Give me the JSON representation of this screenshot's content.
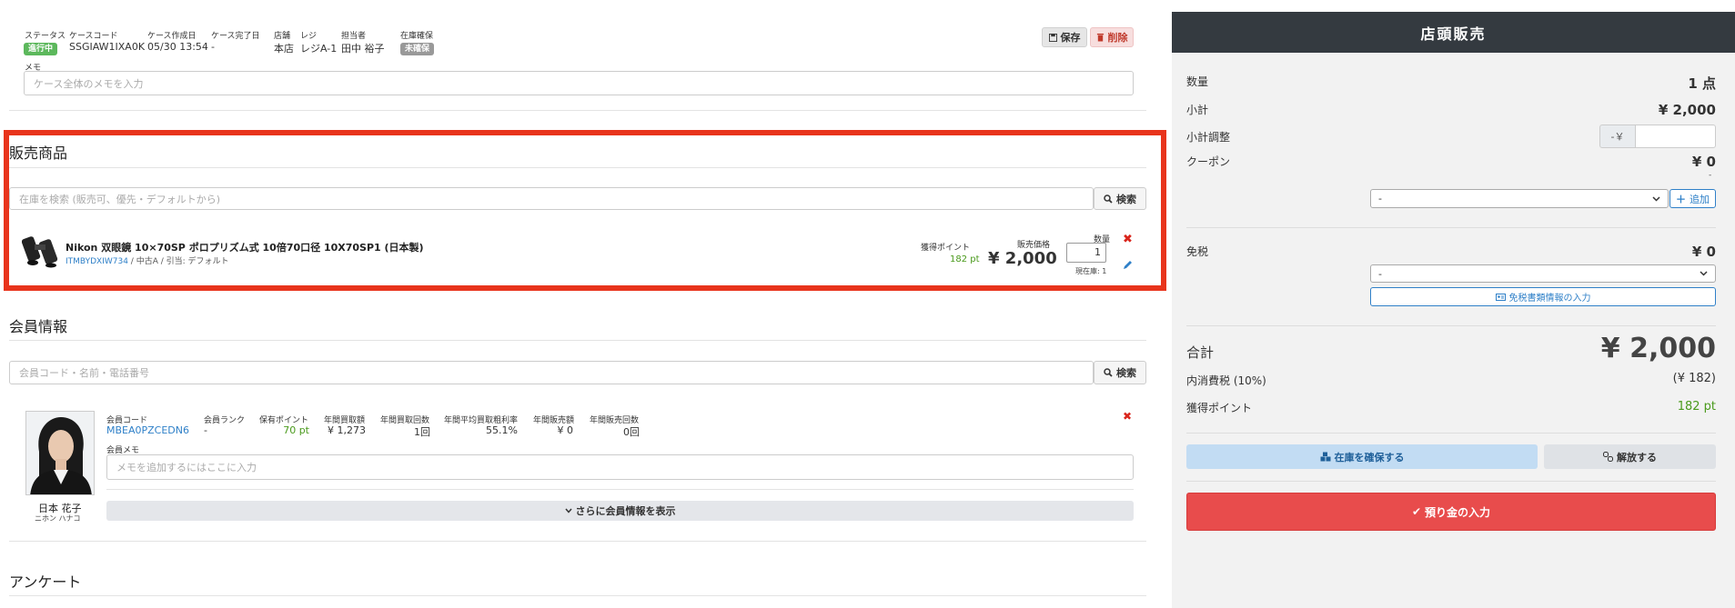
{
  "case": {
    "status_label": "ステータス",
    "status_value": "進行中",
    "status_color": "#5cb85c",
    "code_label": "ケースコード",
    "code_value": "SSGIAW1IXA0K",
    "created_label": "ケース作成日",
    "created_value": "05/30 13:54",
    "completed_label": "ケース完了日",
    "completed_value": "-",
    "store_label": "店舗",
    "store_value": "本店",
    "register_label": "レジ",
    "register_value": "レジA-1",
    "staff_label": "担当者",
    "staff_value": "田中 裕子",
    "stock_label": "在庫確保",
    "stock_value": "未確保",
    "save_label": "保存",
    "delete_label": "削除",
    "memo_label": "メモ",
    "memo_placeholder": "ケース全体のメモを入力"
  },
  "products": {
    "title": "販売商品",
    "search_placeholder": "在庫を検索 (販売可、優先・デフォルトから)",
    "search_button": "検索",
    "item": {
      "name": "Nikon 双眼鏡 10×70SP ポロプリズム式 10倍70口径 10X70SP1 (日本製)",
      "code": "ITMBYDXIW734",
      "meta": " / 中古A / 引当: デフォルト",
      "points_label": "獲得ポイント",
      "points_value": "182 pt",
      "price_label": "販売価格",
      "price_value": "¥ 2,000",
      "qty_label": "数量",
      "qty_value": "1",
      "stock_text": "現在庫: 1"
    }
  },
  "member": {
    "title": "会員情報",
    "search_placeholder": "会員コード・名前・電話番号",
    "search_button": "検索",
    "name": "日本 花子",
    "kana": "ニホン ハナコ",
    "code_label": "会員コード",
    "code_value": "MBEA0PZCEDN6",
    "rank_label": "会員ランク",
    "rank_value": "-",
    "points_label": "保有ポイント",
    "points_value": "70 pt",
    "buy_amount_label": "年間買取額",
    "buy_amount_value": "¥ 1,273",
    "buy_count_label": "年間買取回数",
    "buy_count_value": "1回",
    "margin_label": "年間平均買取粗利率",
    "margin_value": "55.1%",
    "sale_amount_label": "年間販売額",
    "sale_amount_value": "¥ 0",
    "sale_count_label": "年間販売回数",
    "sale_count_value": "0回",
    "memo_label": "会員メモ",
    "memo_placeholder": "メモを追加するにはここに入力",
    "more_button": "さらに会員情報を表示"
  },
  "survey": {
    "title": "アンケート"
  },
  "sidebar": {
    "title": "店頭販売",
    "qty_label": "数量",
    "qty_value": "1 点",
    "subtotal_label": "小計",
    "subtotal_value": "¥ 2,000",
    "adjust_label": "小計調整",
    "adjust_prefix": "-￥",
    "coupon_label": "クーポン",
    "coupon_value": "¥ 0",
    "coupon_sub": "-",
    "coupon_select": "-",
    "add_button": "追加",
    "taxfree_label": "免税",
    "taxfree_value": "¥ 0",
    "taxfree_select": "-",
    "taxfree_doc_button": "免税書類情報の入力",
    "total_label": "合計",
    "total_value": "¥ 2,000",
    "tax_label": "内消費税 (10%)",
    "tax_value": "(¥ 182)",
    "points_label": "獲得ポイント",
    "points_value": "182 pt",
    "reserve_button": "在庫を確保する",
    "release_button": "解放する",
    "deposit_button": "預り金の入力"
  },
  "colors": {
    "highlight": "#e8341c",
    "header_bg": "#343a40",
    "deposit": "#e84c4c",
    "reserve": "#c2dcf3"
  }
}
